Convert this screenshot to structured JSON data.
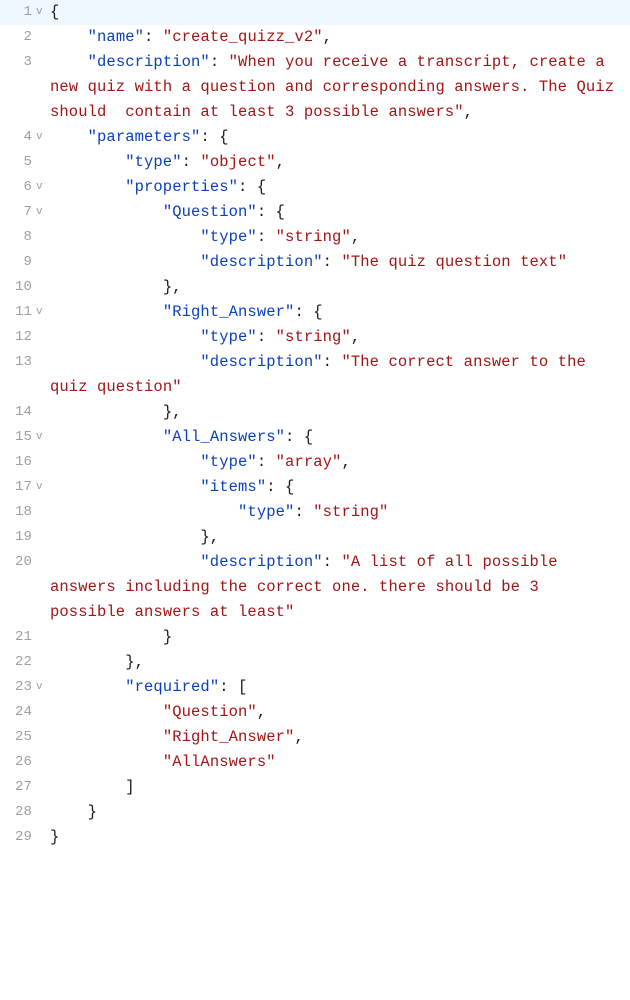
{
  "editor": {
    "highlightedLine": 1,
    "lines": [
      {
        "num": 1,
        "fold": "v",
        "indent": 0,
        "segments": [
          {
            "t": "{",
            "c": "p"
          }
        ]
      },
      {
        "num": 2,
        "fold": "",
        "indent": 2,
        "segments": [
          {
            "t": "\"name\"",
            "c": "k"
          },
          {
            "t": ": ",
            "c": "p"
          },
          {
            "t": "\"create_quizz_v2\"",
            "c": "s"
          },
          {
            "t": ",",
            "c": "p"
          }
        ]
      },
      {
        "num": 3,
        "fold": "",
        "indent": 2,
        "segments": [
          {
            "t": "\"description\"",
            "c": "k"
          },
          {
            "t": ": ",
            "c": "p"
          },
          {
            "t": "\"When you receive a transcript, create a new quiz with a question and corresponding answers. The Quiz should  contain at least 3 possible answers\"",
            "c": "s"
          },
          {
            "t": ",",
            "c": "p"
          }
        ],
        "wrapIndent": 0
      },
      {
        "num": 4,
        "fold": "v",
        "indent": 2,
        "segments": [
          {
            "t": "\"parameters\"",
            "c": "k"
          },
          {
            "t": ": {",
            "c": "p"
          }
        ]
      },
      {
        "num": 5,
        "fold": "",
        "indent": 4,
        "segments": [
          {
            "t": "\"type\"",
            "c": "k"
          },
          {
            "t": ": ",
            "c": "p"
          },
          {
            "t": "\"object\"",
            "c": "s"
          },
          {
            "t": ",",
            "c": "p"
          }
        ]
      },
      {
        "num": 6,
        "fold": "v",
        "indent": 4,
        "segments": [
          {
            "t": "\"properties\"",
            "c": "k"
          },
          {
            "t": ": {",
            "c": "p"
          }
        ]
      },
      {
        "num": 7,
        "fold": "v",
        "indent": 6,
        "segments": [
          {
            "t": "\"Question\"",
            "c": "k"
          },
          {
            "t": ": {",
            "c": "p"
          }
        ]
      },
      {
        "num": 8,
        "fold": "",
        "indent": 8,
        "segments": [
          {
            "t": "\"type\"",
            "c": "k"
          },
          {
            "t": ": ",
            "c": "p"
          },
          {
            "t": "\"string\"",
            "c": "s"
          },
          {
            "t": ",",
            "c": "p"
          }
        ]
      },
      {
        "num": 9,
        "fold": "",
        "indent": 8,
        "segments": [
          {
            "t": "\"description\"",
            "c": "k"
          },
          {
            "t": ": ",
            "c": "p"
          },
          {
            "t": "\"The quiz question text\"",
            "c": "s"
          }
        ]
      },
      {
        "num": 10,
        "fold": "",
        "indent": 6,
        "segments": [
          {
            "t": "},",
            "c": "p"
          }
        ]
      },
      {
        "num": 11,
        "fold": "v",
        "indent": 6,
        "segments": [
          {
            "t": "\"Right_Answer\"",
            "c": "k"
          },
          {
            "t": ": {",
            "c": "p"
          }
        ]
      },
      {
        "num": 12,
        "fold": "",
        "indent": 8,
        "segments": [
          {
            "t": "\"type\"",
            "c": "k"
          },
          {
            "t": ": ",
            "c": "p"
          },
          {
            "t": "\"string\"",
            "c": "s"
          },
          {
            "t": ",",
            "c": "p"
          }
        ]
      },
      {
        "num": 13,
        "fold": "",
        "indent": 8,
        "segments": [
          {
            "t": "\"description\"",
            "c": "k"
          },
          {
            "t": ": ",
            "c": "p"
          },
          {
            "t": "\"The correct answer to the quiz question\"",
            "c": "s"
          }
        ],
        "wrapIndent": 0
      },
      {
        "num": 14,
        "fold": "",
        "indent": 6,
        "segments": [
          {
            "t": "},",
            "c": "p"
          }
        ]
      },
      {
        "num": 15,
        "fold": "v",
        "indent": 6,
        "segments": [
          {
            "t": "\"All_Answers\"",
            "c": "k"
          },
          {
            "t": ": {",
            "c": "p"
          }
        ]
      },
      {
        "num": 16,
        "fold": "",
        "indent": 8,
        "segments": [
          {
            "t": "\"type\"",
            "c": "k"
          },
          {
            "t": ": ",
            "c": "p"
          },
          {
            "t": "\"array\"",
            "c": "s"
          },
          {
            "t": ",",
            "c": "p"
          }
        ]
      },
      {
        "num": 17,
        "fold": "v",
        "indent": 8,
        "segments": [
          {
            "t": "\"items\"",
            "c": "k"
          },
          {
            "t": ": {",
            "c": "p"
          }
        ]
      },
      {
        "num": 18,
        "fold": "",
        "indent": 10,
        "segments": [
          {
            "t": "\"type\"",
            "c": "k"
          },
          {
            "t": ": ",
            "c": "p"
          },
          {
            "t": "\"string\"",
            "c": "s"
          }
        ]
      },
      {
        "num": 19,
        "fold": "",
        "indent": 8,
        "segments": [
          {
            "t": "},",
            "c": "p"
          }
        ]
      },
      {
        "num": 20,
        "fold": "",
        "indent": 8,
        "segments": [
          {
            "t": "\"description\"",
            "c": "k"
          },
          {
            "t": ": ",
            "c": "p"
          },
          {
            "t": "\"A list of all possible answers including the correct one. there should be 3 possible answers at least\"",
            "c": "s"
          }
        ],
        "wrapIndent": 0
      },
      {
        "num": 21,
        "fold": "",
        "indent": 6,
        "segments": [
          {
            "t": "}",
            "c": "p"
          }
        ]
      },
      {
        "num": 22,
        "fold": "",
        "indent": 4,
        "segments": [
          {
            "t": "},",
            "c": "p"
          }
        ]
      },
      {
        "num": 23,
        "fold": "v",
        "indent": 4,
        "segments": [
          {
            "t": "\"required\"",
            "c": "k"
          },
          {
            "t": ": [",
            "c": "p"
          }
        ]
      },
      {
        "num": 24,
        "fold": "",
        "indent": 6,
        "segments": [
          {
            "t": "\"Question\"",
            "c": "s"
          },
          {
            "t": ",",
            "c": "p"
          }
        ]
      },
      {
        "num": 25,
        "fold": "",
        "indent": 6,
        "segments": [
          {
            "t": "\"Right_Answer\"",
            "c": "s"
          },
          {
            "t": ",",
            "c": "p"
          }
        ]
      },
      {
        "num": 26,
        "fold": "",
        "indent": 6,
        "segments": [
          {
            "t": "\"AllAnswers\"",
            "c": "s"
          }
        ]
      },
      {
        "num": 27,
        "fold": "",
        "indent": 4,
        "segments": [
          {
            "t": "]",
            "c": "p"
          }
        ]
      },
      {
        "num": 28,
        "fold": "",
        "indent": 2,
        "segments": [
          {
            "t": "}",
            "c": "p"
          }
        ]
      },
      {
        "num": 29,
        "fold": "",
        "indent": 0,
        "segments": [
          {
            "t": "}",
            "c": "p"
          }
        ]
      }
    ]
  }
}
